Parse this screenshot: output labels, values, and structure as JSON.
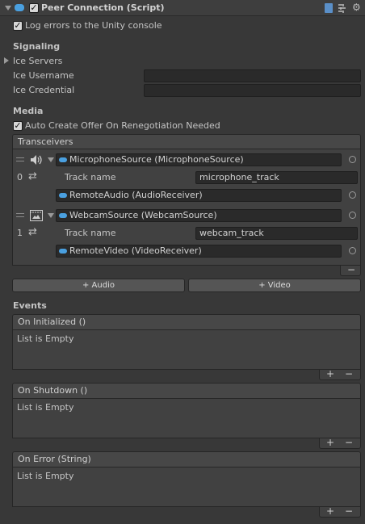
{
  "component": {
    "title": "Peer Connection (Script)",
    "enabled": true,
    "log_errors": {
      "label": "Log errors to the Unity console",
      "checked": true
    }
  },
  "signaling": {
    "heading": "Signaling",
    "ice_servers_label": "Ice Servers",
    "ice_username_label": "Ice Username",
    "ice_username_value": "",
    "ice_credential_label": "Ice Credential",
    "ice_credential_value": ""
  },
  "media": {
    "heading": "Media",
    "auto_offer": {
      "label": "Auto Create Offer On Renegotiation Needed",
      "checked": true
    },
    "transceivers_label": "Transceivers",
    "transceivers": [
      {
        "index": "0",
        "kind": "audio",
        "source": "MicrophoneSource (MicrophoneSource)",
        "track_name_label": "Track name",
        "track_name": "microphone_track",
        "receiver": "RemoteAudio (AudioReceiver)"
      },
      {
        "index": "1",
        "kind": "video",
        "source": "WebcamSource (WebcamSource)",
        "track_name_label": "Track name",
        "track_name": "webcam_track",
        "receiver": "RemoteVideo (VideoReceiver)"
      }
    ],
    "remove_label": "−",
    "add_audio_label": "+ Audio",
    "add_video_label": "+ Video"
  },
  "events": {
    "heading": "Events",
    "items": [
      {
        "title": "On Initialized ()",
        "content": "List is Empty",
        "add": "+",
        "remove": "−"
      },
      {
        "title": "On Shutdown ()",
        "content": "List is Empty",
        "add": "+",
        "remove": "−"
      },
      {
        "title": "On Error (String)",
        "content": "List is Empty",
        "add": "+",
        "remove": "−"
      }
    ]
  },
  "icons": [
    "foldout-arrow-icon",
    "script-icon",
    "help-book-icon",
    "preset-icon",
    "gear-icon",
    "speaker-icon",
    "film-icon",
    "swap-arrows-icon",
    "drag-handle-icon",
    "object-picker-icon"
  ],
  "colors": {
    "background": "#383838",
    "field": "#2a2a2a",
    "accent": "#4aa0e0"
  }
}
